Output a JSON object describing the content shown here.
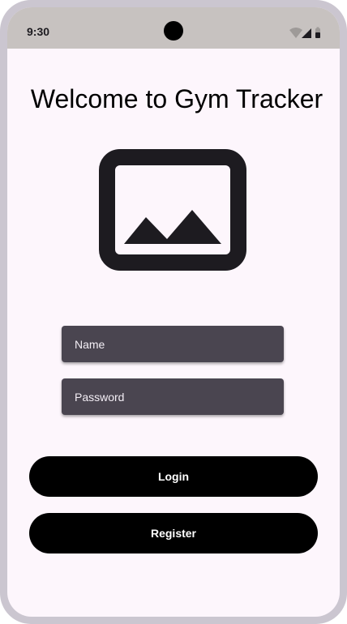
{
  "status_bar": {
    "time": "9:30",
    "icons": [
      "wifi-icon",
      "cellular-signal-icon",
      "battery-icon"
    ]
  },
  "main": {
    "title": "Welcome to Gym Tracker",
    "image_icon": "image-placeholder-icon",
    "name_field": {
      "placeholder": "Name",
      "value": ""
    },
    "password_field": {
      "placeholder": "Password",
      "value": ""
    },
    "login_label": "Login",
    "register_label": "Register"
  },
  "colors": {
    "background": "#fdf6fc",
    "status_bar": "#c7c2c0",
    "field": "#4a4550",
    "button": "#000000",
    "button_text": "#ffffff"
  }
}
